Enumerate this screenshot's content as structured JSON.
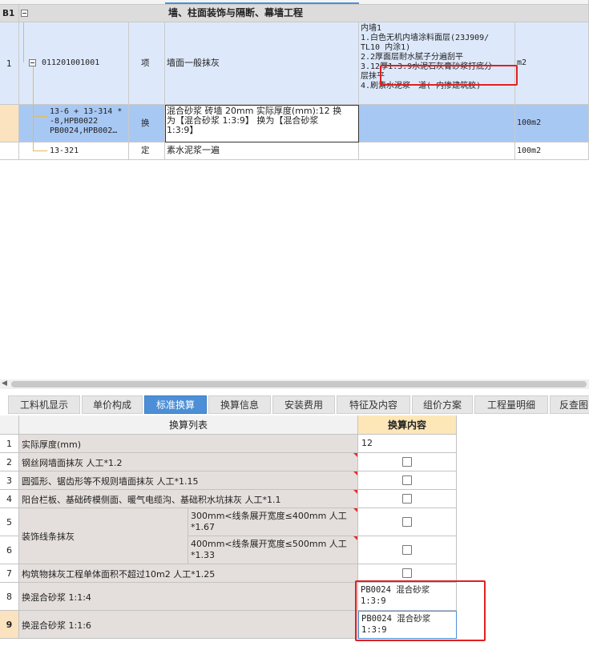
{
  "top_grid": {
    "section": {
      "code": "B1",
      "title": "墙、柱面装饰与隔断、幕墙工程"
    },
    "rows": [
      {
        "index": "1",
        "code": "011201001001",
        "type": "项",
        "name": "墙面一般抹灰",
        "feature": "内墙1\n1.白色无机内墙涂料面层(23J909/\nTL10 内涂1)\n2.2厚面层耐水腻子分遍刮平\n3.12厚1:3:9水泥石灰膏砂浆打底分\n层抹平\n4.刷素水泥浆一道( 内掺建筑胶)",
        "unit": "m2"
      },
      {
        "index": "",
        "code": "13-6 + 13-314 *\n-8,HPB0022\nPB0024,HPB002…",
        "type": "换",
        "name": "混合砂浆 砖墙 20mm  实际厚度(mm):12  换\n为【混合砂浆 1:3:9】  换为【混合砂浆\n1:3:9】",
        "feature": "",
        "unit": "100m2"
      },
      {
        "index": "",
        "code": "13-321",
        "type": "定",
        "name": "素水泥浆一遍",
        "feature": "",
        "unit": "100m2"
      }
    ]
  },
  "tabs": [
    {
      "label": "工料机显示",
      "active": false
    },
    {
      "label": "单价构成",
      "active": false
    },
    {
      "label": "标准换算",
      "active": true
    },
    {
      "label": "换算信息",
      "active": false
    },
    {
      "label": "安装费用",
      "active": false
    },
    {
      "label": "特征及内容",
      "active": false
    },
    {
      "label": "组价方案",
      "active": false
    },
    {
      "label": "工程量明细",
      "active": false
    },
    {
      "label": "反查图",
      "active": false
    }
  ],
  "std_conv": {
    "col_list": "换算列表",
    "col_content": "换算内容",
    "rows": [
      {
        "n": "1",
        "label": "实际厚度(mm)",
        "value": "12"
      },
      {
        "n": "2",
        "label": "钢丝网墙面抹灰 人工*1.2",
        "checkbox": true
      },
      {
        "n": "3",
        "label": "圆弧形、锯齿形等不规则墙面抹灰 人工*1.15",
        "checkbox": true
      },
      {
        "n": "4",
        "label": "阳台栏板、基础砖模侧面、暖气电缆沟、基础积水坑抹灰 人工*1.1",
        "checkbox": true
      },
      {
        "n": "5",
        "group": "装饰线条抹灰",
        "label": "300mm<线条展开宽度≤400mm 人工\n*1.67",
        "checkbox": true
      },
      {
        "n": "6",
        "group": "装饰线条抹灰",
        "label": "400mm<线条展开宽度≤500mm 人工\n*1.33",
        "checkbox": true
      },
      {
        "n": "7",
        "label": "构筑物抹灰工程单体面积不超过10m2 人工*1.25",
        "checkbox": true
      },
      {
        "n": "8",
        "label": "换混合砂浆 1:1:4",
        "value": "PB0024   混合砂浆\n1:3:9"
      },
      {
        "n": "9",
        "label": "换混合砂浆 1:1:6",
        "value": "PB0024   混合砂浆\n1:3:9"
      }
    ],
    "group_label": "装饰线条抹灰"
  },
  "colors": {
    "accent": "#4d8fd6",
    "highlight_red": "#e02020",
    "selected_row": "#a8c8f4",
    "row_light": "#dde9fb"
  }
}
